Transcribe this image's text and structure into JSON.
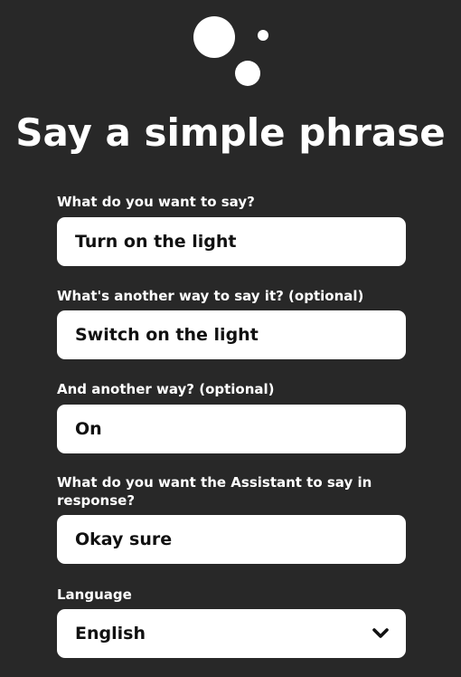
{
  "header": {
    "title": "Say a simple phrase",
    "logo_icon": "assistant-dots-icon"
  },
  "form": {
    "fields": [
      {
        "label": "What do you want to say?",
        "value": "Turn on the light"
      },
      {
        "label": "What's another way to say it? (optional)",
        "value": "Switch on the light"
      },
      {
        "label": "And another way? (optional)",
        "value": "On"
      },
      {
        "label": "What do you want the Assistant to say in response?",
        "value": "Okay sure"
      }
    ],
    "language": {
      "label": "Language",
      "selected": "English",
      "icon": "chevron-down-icon"
    }
  },
  "colors": {
    "background": "#282828",
    "text": "#ffffff",
    "input_background": "#ffffff",
    "input_text": "#111111"
  }
}
